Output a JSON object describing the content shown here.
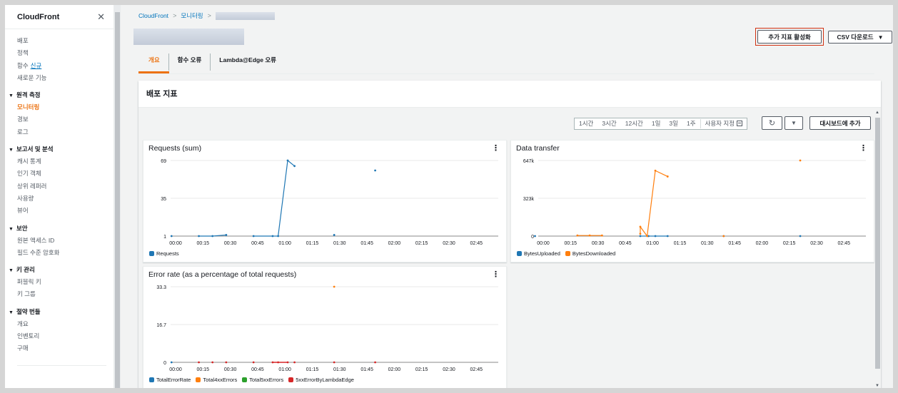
{
  "sidebar": {
    "title": "CloudFront",
    "top_items": [
      {
        "label": "배포"
      },
      {
        "label": "정책"
      },
      {
        "label": "함수",
        "badge": "신규"
      },
      {
        "label": "새로운 기능"
      }
    ],
    "sections": [
      {
        "title": "원격 측정",
        "items": [
          "모니터링",
          "경보",
          "로그"
        ],
        "active": "모니터링"
      },
      {
        "title": "보고서 및 분석",
        "items": [
          "캐시 통계",
          "인기 객체",
          "상위 레퍼러",
          "사용량",
          "뷰어"
        ]
      },
      {
        "title": "보안",
        "items": [
          "원본 액세스 ID",
          "필드 수준 암호화"
        ]
      },
      {
        "title": "키 관리",
        "items": [
          "퍼블릭 키",
          "키 그룹"
        ]
      },
      {
        "title": "절약 번들",
        "items": [
          "개요",
          "인벤토리",
          "구매"
        ]
      }
    ]
  },
  "breadcrumb": {
    "root": "CloudFront",
    "monitoring": "모니터링"
  },
  "header": {
    "enable_metrics_label": "추가 지표 활성화",
    "csv_label": "CSV 다운로드"
  },
  "tabs": [
    "개요",
    "함수 오류",
    "Lambda@Edge 오류"
  ],
  "panel": {
    "title": "배포 지표",
    "time_ranges": [
      "1시간",
      "3시간",
      "12시간",
      "1일",
      "3일",
      "1주"
    ],
    "custom_range_label": "사용자 지정",
    "add_dashboard_label": "대시보드에 추가"
  },
  "colors": {
    "blue": "#1f77b4",
    "orange": "#ff7f0e",
    "green": "#2ca02c",
    "red": "#d62728",
    "accent": "#ec7211",
    "link": "#0073bb"
  },
  "chart_data": [
    {
      "type": "line",
      "title": "Requests (sum)",
      "x": [
        "00:00",
        "00:15",
        "00:30",
        "00:45",
        "01:00",
        "01:15",
        "01:30",
        "01:45",
        "02:00",
        "02:15",
        "02:30",
        "02:45"
      ],
      "y_ticks": [
        "69",
        "35",
        "1"
      ],
      "ylim": [
        1,
        69
      ],
      "series": [
        {
          "name": "Requests",
          "color": "#1f77b4",
          "points": [
            [
              -0.15,
              1
            ],
            [
              0.85,
              1
            ],
            [
              1.35,
              1
            ],
            [
              1.85,
              2
            ],
            [
              2.85,
              1
            ],
            [
              3.55,
              1
            ],
            [
              3.75,
              1
            ],
            [
              4.1,
              69
            ],
            [
              4.35,
              64
            ],
            [
              5.8,
              2
            ],
            [
              7.3,
              60
            ]
          ]
        }
      ],
      "legend": [
        "Requests"
      ]
    },
    {
      "type": "line",
      "title": "Data transfer",
      "x": [
        "00:00",
        "00:15",
        "00:30",
        "00:45",
        "01:00",
        "01:15",
        "01:30",
        "01:45",
        "02:00",
        "02:15",
        "02:30",
        "02:45"
      ],
      "y_ticks": [
        "647k",
        "323k",
        "0"
      ],
      "ylim": [
        0,
        647
      ],
      "series": [
        {
          "name": "BytesUploaded",
          "color": "#1f77b4",
          "points": [
            [
              -0.3,
              0
            ],
            [
              3.55,
              0
            ],
            [
              3.85,
              0
            ],
            [
              4.1,
              0
            ],
            [
              4.55,
              0
            ],
            [
              6.6,
              0
            ],
            [
              9.4,
              0
            ]
          ]
        },
        {
          "name": "BytesDownloaded",
          "color": "#ff7f0e",
          "points": [
            [
              1.25,
              5
            ],
            [
              1.7,
              5
            ],
            [
              2.15,
              5
            ],
            [
              3.55,
              20
            ],
            [
              3.55,
              80
            ],
            [
              3.8,
              0
            ],
            [
              4.1,
              560
            ],
            [
              4.55,
              510
            ],
            [
              6.6,
              0
            ],
            [
              9.4,
              647
            ]
          ]
        }
      ],
      "legend": [
        "BytesUploaded",
        "BytesDownloaded"
      ]
    },
    {
      "type": "line",
      "title": "Error rate (as a percentage of total requests)",
      "x": [
        "00:00",
        "00:15",
        "00:30",
        "00:45",
        "01:00",
        "01:15",
        "01:30",
        "01:45",
        "02:00",
        "02:15",
        "02:30",
        "02:45"
      ],
      "y_ticks": [
        "33.3",
        "16.7",
        "0"
      ],
      "ylim": [
        0,
        33.3
      ],
      "series": [
        {
          "name": "TotalErrorRate",
          "color": "#1f77b4",
          "points": [
            [
              -0.15,
              0
            ]
          ]
        },
        {
          "name": "Total4xxErrors",
          "color": "#ff7f0e",
          "points": [
            [
              5.8,
              33.3
            ]
          ]
        },
        {
          "name": "Total5xxErrors",
          "color": "#2ca02c",
          "points": []
        },
        {
          "name": "5xxErrorByLambdaEdge",
          "color": "#d62728",
          "points": [
            [
              0.85,
              0
            ],
            [
              1.35,
              0
            ],
            [
              1.85,
              0
            ],
            [
              2.85,
              0
            ],
            [
              3.55,
              0
            ],
            [
              3.75,
              0
            ],
            [
              4.1,
              0
            ],
            [
              4.35,
              0
            ],
            [
              5.8,
              0
            ],
            [
              7.3,
              0
            ]
          ]
        }
      ],
      "legend": [
        "TotalErrorRate",
        "Total4xxErrors",
        "Total5xxErrors",
        "5xxErrorByLambdaEdge"
      ]
    }
  ]
}
